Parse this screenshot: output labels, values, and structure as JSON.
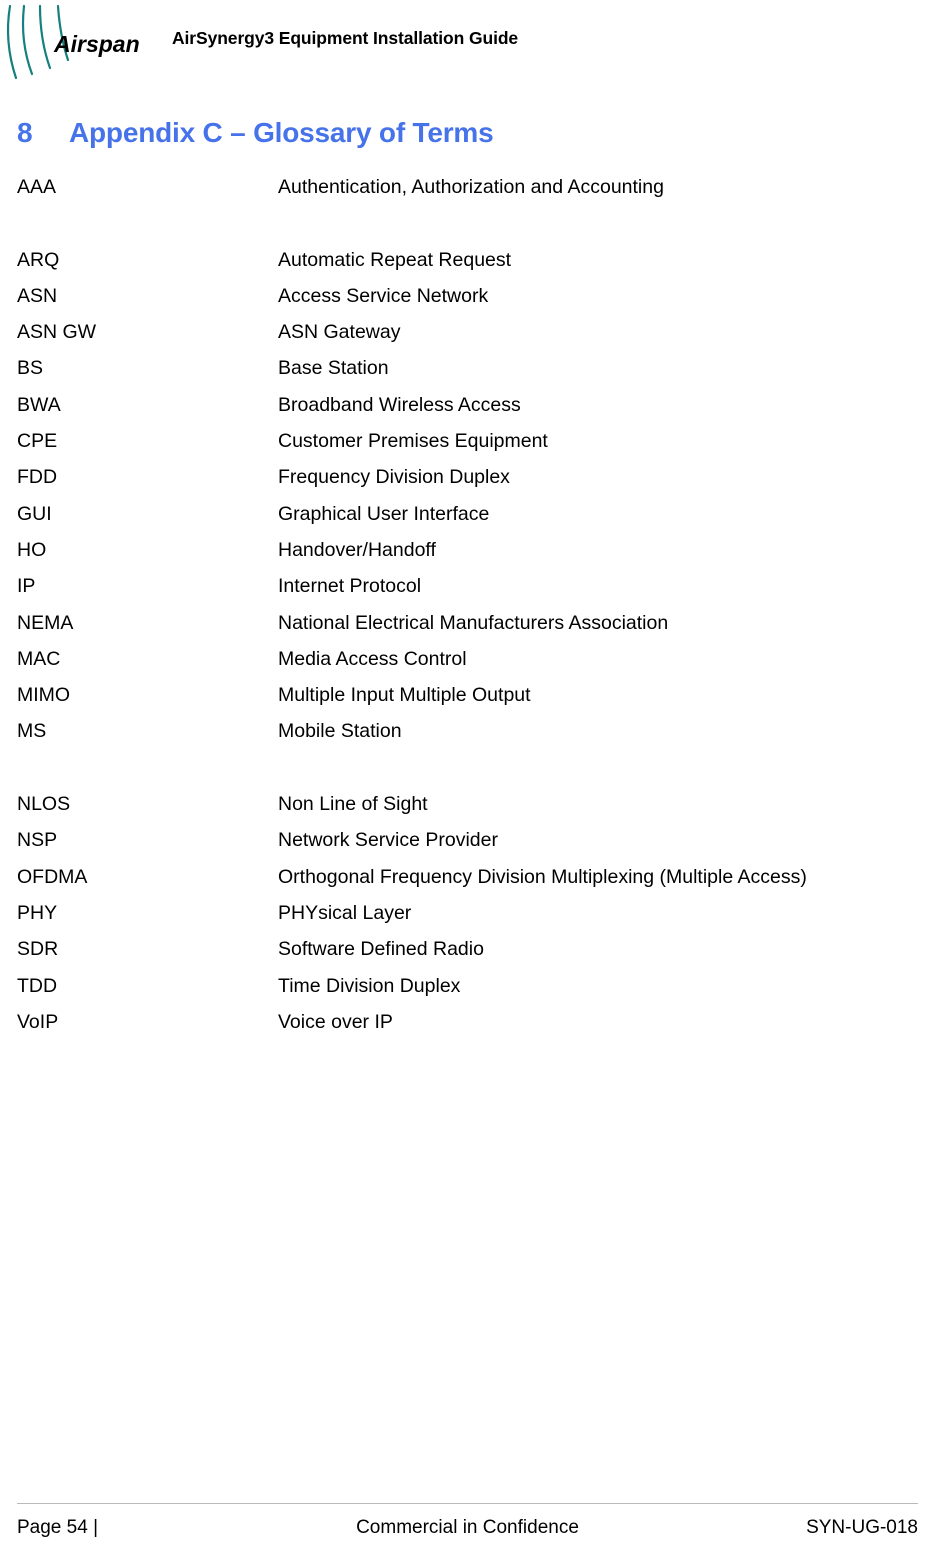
{
  "header": {
    "logo_name": "airspan-logo",
    "logo_wordmark": "Airspan",
    "logo_arc_color": "#17807f",
    "document_title": "AirSynergy3 Equipment Installation Guide"
  },
  "section": {
    "number": "8",
    "title": "Appendix C  – Glossary of Terms",
    "color": "#4672EA"
  },
  "glossary": {
    "rows": [
      {
        "term": "AAA",
        "definition": "Authentication, Authorization and Accounting"
      },
      {
        "term": "",
        "definition": ""
      },
      {
        "term": "ARQ",
        "definition": "Automatic Repeat Request"
      },
      {
        "term": "ASN",
        "definition": "Access Service Network"
      },
      {
        "term": "ASN GW",
        "definition": "ASN Gateway"
      },
      {
        "term": "BS",
        "definition": "Base Station"
      },
      {
        "term": "BWA",
        "definition": "Broadband Wireless Access"
      },
      {
        "term": "CPE",
        "definition": "Customer Premises Equipment"
      },
      {
        "term": "FDD",
        "definition": "Frequency Division Duplex"
      },
      {
        "term": "GUI",
        "definition": "Graphical User Interface"
      },
      {
        "term": "HO",
        "definition": "Handover/Handoff"
      },
      {
        "term": "IP",
        "definition": "Internet Protocol"
      },
      {
        "term": "NEMA",
        "definition": "National Electrical Manufacturers Association"
      },
      {
        "term": "MAC",
        "definition": "Media Access Control"
      },
      {
        "term": "MIMO",
        "definition": "Multiple Input Multiple Output"
      },
      {
        "term": "MS",
        "definition": "Mobile Station"
      },
      {
        "term": "",
        "definition": ""
      },
      {
        "term": "NLOS",
        "definition": "Non Line of Sight"
      },
      {
        "term": "NSP",
        "definition": "Network Service Provider"
      },
      {
        "term": "OFDMA",
        "definition": "Orthogonal Frequency Division Multiplexing (Multiple Access)"
      },
      {
        "term": "PHY",
        "definition": "PHYsical Layer"
      },
      {
        "term": "SDR",
        "definition": "Software Defined Radio"
      },
      {
        "term": "TDD",
        "definition": "Time Division Duplex"
      },
      {
        "term": "VoIP",
        "definition": "Voice over IP"
      }
    ]
  },
  "footer": {
    "left": "Page 54 |",
    "center": "Commercial in Confidence",
    "right": "SYN-UG-018"
  }
}
